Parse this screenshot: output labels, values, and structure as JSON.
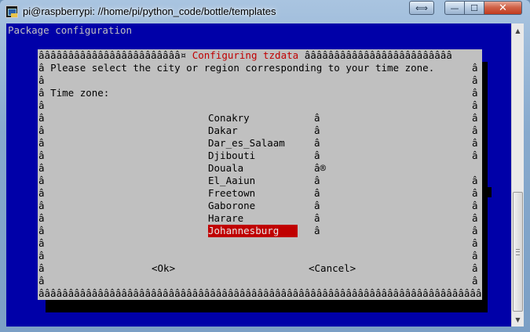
{
  "window": {
    "title": "pi@raspberrypi: //home/pi/python_code/bottle/templates",
    "restore_icon": "⟺",
    "minimize_icon": "—",
    "maximize_icon": "☐",
    "close_icon": "✕"
  },
  "terminal": {
    "package_title": "Package configuration",
    "dialog": {
      "top_border_left": "ââââââââââââââââââââââââ¤",
      "title": "Configuring tzdata",
      "top_border_right": "âââââââââââââââââââââââââ",
      "prompt": "Please select the city or region corresponding to your time zone.",
      "field_label": "Time zone:",
      "edge_char": "â",
      "list_marker": "â",
      "scroll_marker": "â®",
      "options": [
        "Conakry",
        "Dakar",
        "Dar_es_Salaam",
        "Djibouti",
        "Douala",
        "El_Aaiun",
        "Freetown",
        "Gaborone",
        "Harare",
        "Johannesburg"
      ],
      "selected_option": "Johannesburg",
      "ok_label": "<Ok>",
      "cancel_label": "<Cancel>",
      "bottom_border": "ââââââââââââââââââââââââââââââââââââââââââââââââââââââââââââââââââââââââââââ"
    }
  },
  "colors": {
    "terminal_bg": "#0000a8",
    "dialog_bg": "#c0c0c0",
    "title_red": "#c00000",
    "highlight": "#c00000",
    "shadow": "#000000"
  },
  "scrollbar": {
    "up_icon": "▲",
    "down_icon": "▼"
  }
}
